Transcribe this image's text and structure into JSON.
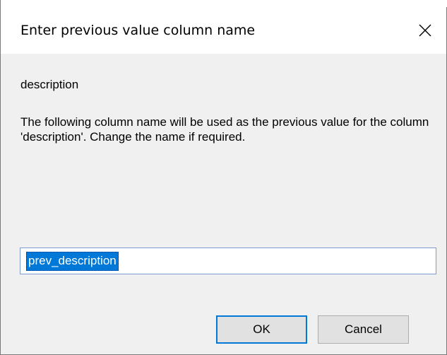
{
  "dialog": {
    "title": "Enter previous value column name",
    "close_icon": "close-icon",
    "field_label": "description",
    "explanation": "The following column name will be used as the previous value for the column 'description'. Change the name if required.",
    "input_value": "prev_description",
    "ok_label": "OK",
    "cancel_label": "Cancel"
  },
  "colors": {
    "selection": "#0078d7",
    "dialog_background": "#f0f0f0",
    "titlebar_background": "#ffffff"
  }
}
